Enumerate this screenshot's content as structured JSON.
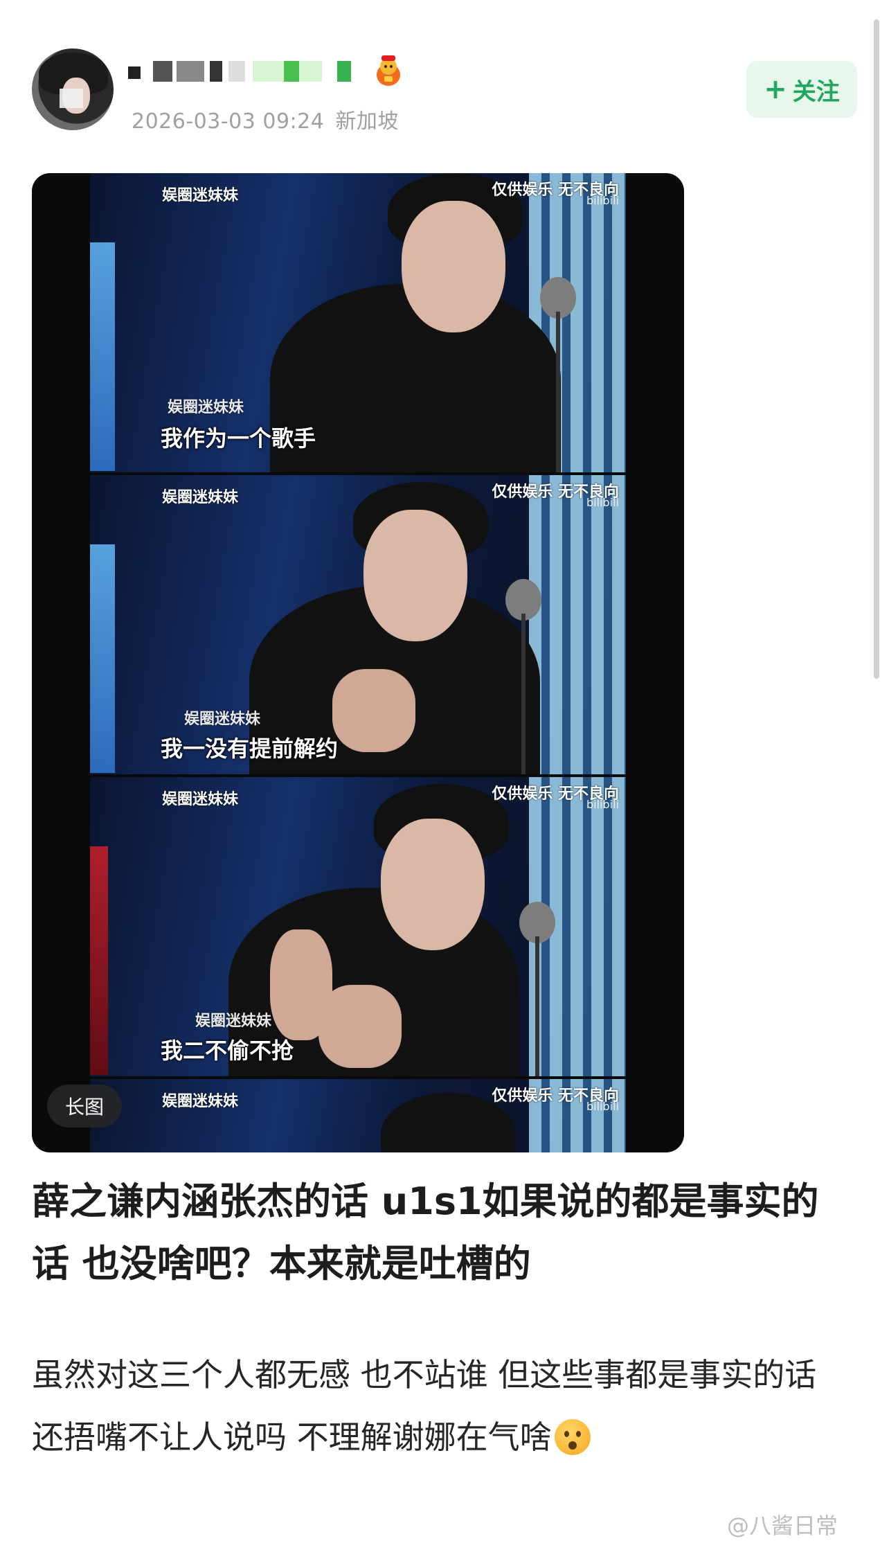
{
  "header": {
    "timestamp": "2026-03-03 09:24",
    "location": "新加坡",
    "follow_label": "关注",
    "follow_icon": "plus-icon"
  },
  "media": {
    "watermark_top_left": "娱圈迷妹妹",
    "watermark_top_right": "仅供娱乐 无不良向",
    "watermark_brand": "bilibili",
    "frames": [
      {
        "subtitle": "我作为一个歌手",
        "mid_watermark": "娱圈迷妹妹"
      },
      {
        "subtitle": "我一没有提前解约",
        "mid_watermark": "娱圈迷妹妹"
      },
      {
        "subtitle": "我二不偷不抢",
        "mid_watermark": "娱圈迷妹妹"
      },
      {
        "subtitle": "",
        "mid_watermark": ""
      }
    ],
    "long_image_badge": "长图"
  },
  "post": {
    "title": "薛之谦内涵张杰的话 u1s1如果说的都是事实的话 也没啥吧？本来就是吐槽的",
    "body": "虽然对这三个人都无感 也不站谁 但这些事都是事实的话 还捂嘴不让人说吗 不理解谢娜在气啥",
    "emoji": "surprised-face-emoji"
  },
  "footer": {
    "watermark": "@八酱日常"
  },
  "colors": {
    "follow_green": "#1fa85b",
    "follow_bg": "#e7f7ec",
    "timestamp_gray": "#a0a0a0"
  }
}
